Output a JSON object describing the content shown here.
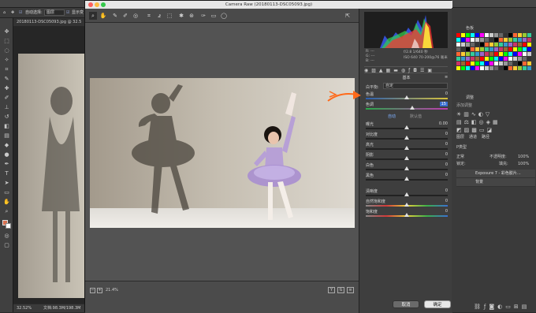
{
  "app": {
    "options_bar": {
      "auto_select_label": "自动选择:",
      "layer_select_value": "图层",
      "show_transform_label": "显示变"
    },
    "doc_tab": "20180113-DSC05093.jpg @ 32.5",
    "status": {
      "zoom": "32.52%",
      "doc_size": "文档:98.3M/198.3M"
    }
  },
  "camera_raw": {
    "title": "Camera Raw (20180113-DSC05093.jpg)",
    "zoom_level": "21.4%",
    "cancel_label": "取消",
    "ok_label": "确定",
    "camera_info": {
      "r": "R:",
      "g": "G:",
      "b": "B:",
      "dashes": "---",
      "aperture_shutter": "f/2.8  1/640 秒",
      "iso_lens": "ISO 640  70-200@76 毫米"
    },
    "panel_title": "基本",
    "wb_label": "白平衡:",
    "wb_value": "自定",
    "auto_label": "自动",
    "default_label": "默认值",
    "sliders": [
      {
        "label": "色温",
        "value": "0",
        "pos": 0.5
      },
      {
        "label": "色调",
        "value": "15",
        "pos": 0.57
      },
      {
        "label": "曝光",
        "value": "0.00",
        "pos": 0.5
      },
      {
        "label": "对比度",
        "value": "0",
        "pos": 0.5
      },
      {
        "label": "高光",
        "value": "0",
        "pos": 0.5
      },
      {
        "label": "阴影",
        "value": "0",
        "pos": 0.5
      },
      {
        "label": "白色",
        "value": "0",
        "pos": 0.5
      },
      {
        "label": "黑色",
        "value": "0",
        "pos": 0.5
      },
      {
        "label": "清晰度",
        "value": "0",
        "pos": 0.5
      },
      {
        "label": "自然饱和度",
        "value": "0",
        "pos": 0.5
      },
      {
        "label": "饱和度",
        "value": "0",
        "pos": 0.5
      }
    ]
  },
  "ps_panels": {
    "color_tab": "色板",
    "adjust_tab": "调整",
    "adjust_title": "添加调整",
    "layers_tabs": [
      "图层",
      "通道",
      "路径"
    ],
    "kind_label": "P类型",
    "blend_mode": "正常",
    "opacity_label": "不透明度:",
    "opacity_value": "100%",
    "lock_label": "锁定:",
    "fill_label": "填充:",
    "fill_value": "100%",
    "layers": [
      {
        "name": "Exposure 7 - 彩色胶片..."
      },
      {
        "name": "背景"
      }
    ]
  }
}
